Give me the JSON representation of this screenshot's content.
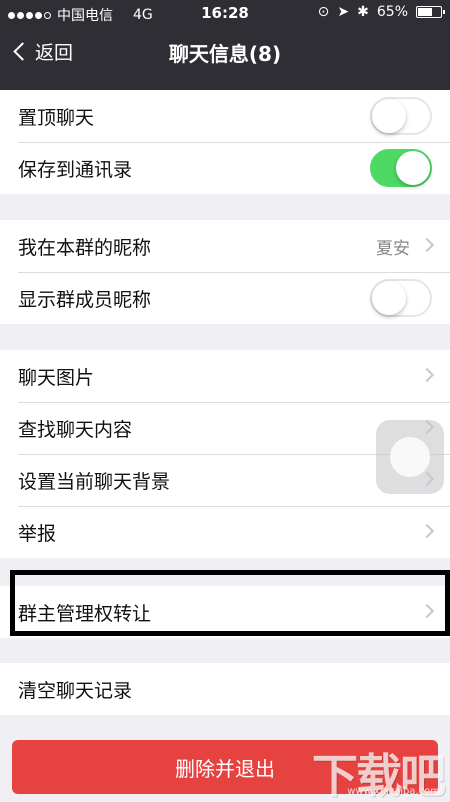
{
  "status_bar": {
    "carrier": "中国电信",
    "network": "4G",
    "time": "16:28",
    "battery": "65%",
    "battery_level": 0.65
  },
  "nav": {
    "back_label": "返回",
    "title": "聊天信息(8)"
  },
  "group1": {
    "items": [
      {
        "label": "置顶聊天",
        "toggle": false
      },
      {
        "label": "保存到通讯录",
        "toggle": true
      }
    ]
  },
  "group2": {
    "items": [
      {
        "label": "我在本群的昵称",
        "value": "夏安"
      },
      {
        "label": "显示群成员昵称",
        "toggle": false
      }
    ]
  },
  "group3": {
    "items": [
      {
        "label": "聊天图片"
      },
      {
        "label": "查找聊天内容"
      },
      {
        "label": "设置当前聊天背景"
      },
      {
        "label": "举报"
      }
    ]
  },
  "group4": {
    "items": [
      {
        "label": "群主管理权转让"
      }
    ]
  },
  "group5": {
    "items": [
      {
        "label": "清空聊天记录"
      }
    ]
  },
  "delete_button": "删除并退出",
  "watermark": {
    "text": "下载吧",
    "url": "www.xiazaiba.com"
  },
  "colors": {
    "nav_bg": "#2f2e34",
    "toggle_on": "#4cd964",
    "danger": "#e64340"
  }
}
